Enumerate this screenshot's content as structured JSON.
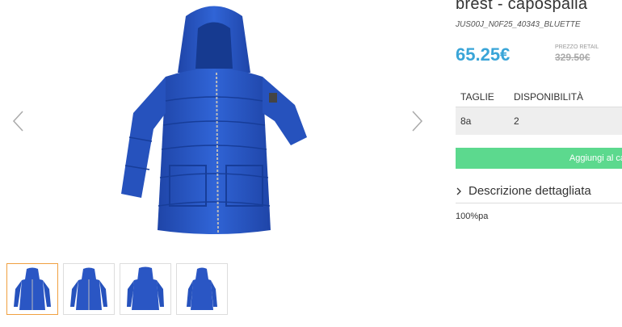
{
  "product": {
    "title": "brest - capospalla",
    "sku": "JUS00J_N0F25_40343_BLUETTE",
    "price": "65.25€",
    "retail_label": "PREZZO RETAIL",
    "retail_price": "329.50€"
  },
  "availability": {
    "headers": [
      "TAGLIE",
      "DISPONIBILITÀ"
    ],
    "rows": [
      {
        "size": "8a",
        "qty": "2"
      }
    ]
  },
  "add_to_cart_label": "Aggiungi al ca",
  "description": {
    "toggle_label": "Descrizione dettagliata",
    "text": "100%pa"
  },
  "colors": {
    "accent": "#3aa5d8",
    "button": "#5cd98e",
    "jacket": "#2a56c4"
  },
  "icons": {
    "prev": "chevron-left-icon",
    "next": "chevron-right-icon",
    "toggle": "chevron-right-icon"
  }
}
